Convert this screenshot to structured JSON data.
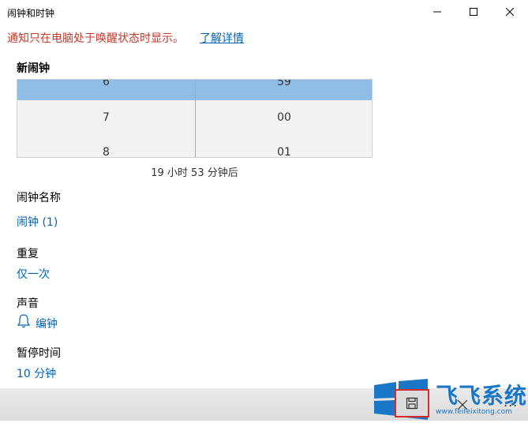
{
  "window": {
    "title": "闹钟和时钟",
    "minimize_icon": "minimize-icon",
    "maximize_icon": "maximize-icon",
    "close_icon": "close-icon"
  },
  "notice": {
    "text": "通知只在电脑处于唤醒状态时显示。",
    "link": "了解详情",
    "color": "#c0392b",
    "link_color": "#0063b1"
  },
  "alarm": {
    "section_title": "新闹钟",
    "picker": {
      "hours": [
        "6",
        "7",
        "8"
      ],
      "minutes": [
        "59",
        "00",
        "01"
      ],
      "selection_color": "#8fbde6"
    },
    "countdown": "19 小时 53 分钟后",
    "name_label": "闹钟名称",
    "name_value": "闹钟 (1)",
    "repeat_label": "重复",
    "repeat_value": "仅一次",
    "sound_label": "声音",
    "sound_value": "编钟",
    "sound_icon": "bell-icon",
    "snooze_label": "暂停时间",
    "snooze_value": "10 分钟"
  },
  "command_bar": {
    "save_icon": "save-icon",
    "close_icon": "close-icon",
    "more": "..."
  },
  "watermark": {
    "text": "飞飞系统",
    "url": "www.feifeixitong.com",
    "logo": "windows-logo-icon",
    "color": "#1a77c8"
  }
}
